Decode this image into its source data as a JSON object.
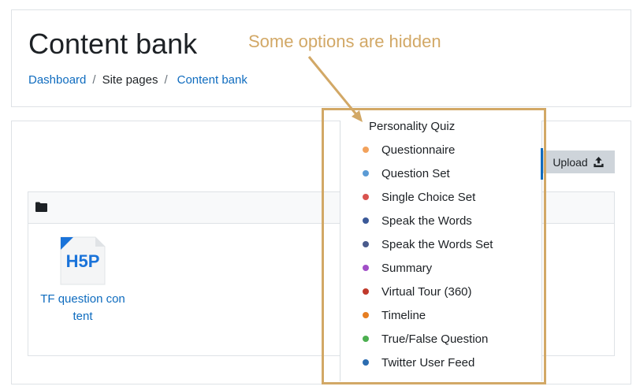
{
  "header": {
    "title": "Content bank",
    "breadcrumb": {
      "dashboard": "Dashboard",
      "separator": "/",
      "site_pages": "Site pages",
      "content_bank": "Content bank"
    }
  },
  "toolbar": {
    "upload_label": "Upload"
  },
  "files": [
    {
      "name": "TF question content",
      "type": "H5P"
    }
  ],
  "h5p_logo_text": "H5P",
  "dropdown": {
    "items": [
      {
        "label": "Personality Quiz"
      },
      {
        "label": "Questionnaire",
        "color": "#f2a25c"
      },
      {
        "label": "Question Set",
        "color": "#5b9bd5"
      },
      {
        "label": "Single Choice Set",
        "color": "#d9534f"
      },
      {
        "label": "Speak the Words",
        "color": "#3b5998"
      },
      {
        "label": "Speak the Words Set",
        "color": "#4a5b8c"
      },
      {
        "label": "Summary",
        "color": "#a14fc7"
      },
      {
        "label": "Virtual Tour (360)",
        "color": "#c0392b"
      },
      {
        "label": "Timeline",
        "color": "#e67e22"
      },
      {
        "label": "True/False Question",
        "color": "#4caf50"
      },
      {
        "label": "Twitter User Feed",
        "color": "#2b6cb0"
      }
    ]
  },
  "annotation": {
    "text": "Some options are hidden",
    "color": "#d2a866"
  }
}
